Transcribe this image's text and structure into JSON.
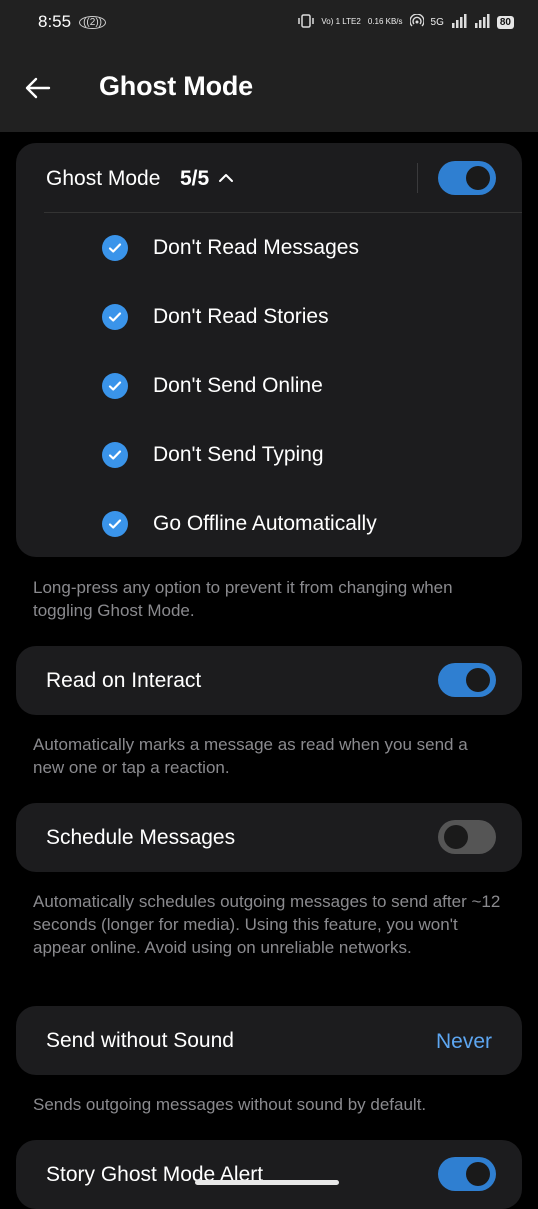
{
  "status_bar": {
    "time": "8:55",
    "call_indicator": "((2))",
    "volte": "Vo) 1 LTE2",
    "speed": "0.16 KB/s",
    "network": "5G",
    "battery": "80"
  },
  "header": {
    "title": "Ghost Mode"
  },
  "ghost_mode": {
    "label": "Ghost Mode",
    "count": "5/5",
    "enabled": true,
    "options": [
      {
        "label": "Don't Read Messages",
        "checked": true
      },
      {
        "label": "Don't Read Stories",
        "checked": true
      },
      {
        "label": "Don't Send Online",
        "checked": true
      },
      {
        "label": "Don't Send Typing",
        "checked": true
      },
      {
        "label": "Go Offline Automatically",
        "checked": true
      }
    ],
    "hint": "Long-press any option to prevent it from changing when toggling Ghost Mode."
  },
  "read_on_interact": {
    "label": "Read on Interact",
    "enabled": true,
    "hint": "Automatically marks a message as read when you send a new one or tap a reaction."
  },
  "schedule_messages": {
    "label": "Schedule Messages",
    "enabled": false,
    "hint": "Automatically schedules outgoing messages to send after ~12 seconds (longer for media). Using this feature, you won't appear online. Avoid using on unreliable networks."
  },
  "send_without_sound": {
    "label": "Send without Sound",
    "value": "Never",
    "hint": "Sends outgoing messages without sound by default."
  },
  "story_ghost_alert": {
    "label": "Story Ghost Mode Alert",
    "enabled": true
  },
  "colors": {
    "accent": "#2f7fd1",
    "check": "#3a94ea",
    "link": "#5da6f1",
    "card": "#1c1c1e",
    "background": "#000000"
  }
}
